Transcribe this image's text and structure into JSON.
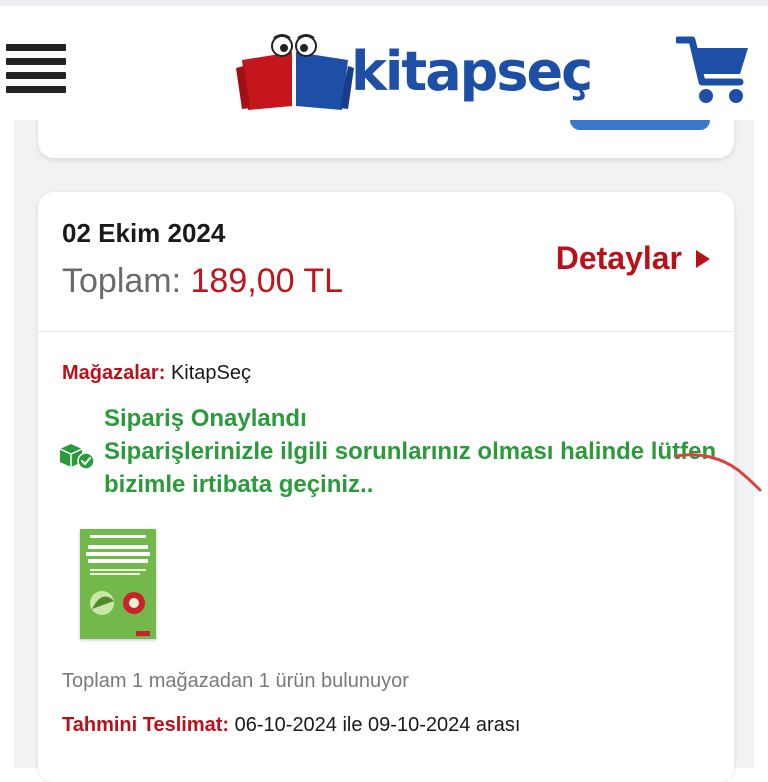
{
  "header": {
    "menu_icon": "hamburger-menu-icon",
    "logo_text": "kitapseç",
    "cart_icon": "shopping-cart-icon",
    "brand_blue": "#1e4fa6",
    "brand_red": "#c5161d"
  },
  "order": {
    "date": "02 Ekim 2024",
    "total_label": "Toplam:",
    "total_value": "189,00 TL",
    "details_label": "Detaylar",
    "stores_label": "Mağazalar:",
    "stores_value": "KitapSeç",
    "status_title": "Sipariş Onaylandı",
    "status_message": "Siparişlerinizle ilgili sorunlarınız olması halinde lütfen bizimle irtibata geçiniz..",
    "status_icon": "package-check-icon",
    "summary": "Toplam 1 mağazadan 1 ürün bulunuyor",
    "delivery_label": "Tahmini Teslimat:",
    "delivery_value": "06-10-2024 ile 09-10-2024 arası"
  },
  "colors": {
    "accent_red": "#b8111a",
    "status_green": "#2b9a3b",
    "card_bg": "#ffffff",
    "page_bg": "#f1f2f4"
  }
}
